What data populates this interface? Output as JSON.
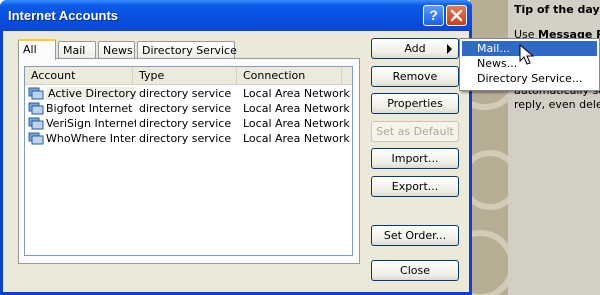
{
  "window": {
    "title": "Internet Accounts",
    "help_label": "?",
    "close_label": "✕"
  },
  "tabs": [
    "All",
    "Mail",
    "News",
    "Directory Service"
  ],
  "list": {
    "columns": [
      "Account",
      "Type",
      "Connection"
    ],
    "rows": [
      {
        "account": "Active Directory",
        "type": "directory service",
        "connection": "Local Area Network"
      },
      {
        "account": "Bigfoot Internet ...",
        "type": "directory service",
        "connection": "Local Area Network"
      },
      {
        "account": "VeriSign Internet ...",
        "type": "directory service",
        "connection": "Local Area Network"
      },
      {
        "account": "WhoWhere Inter...",
        "type": "directory service",
        "connection": "Local Area Network"
      }
    ]
  },
  "buttons": {
    "add": "Add",
    "remove": "Remove",
    "properties": "Properties",
    "set_default": "Set as Default",
    "import": "Import...",
    "export": "Export...",
    "set_order": "Set Order...",
    "close": "Close"
  },
  "add_menu": [
    "Mail...",
    "News...",
    "Directory Service..."
  ],
  "background": {
    "tip_title": "Tip of the day",
    "tip_lines": [
      {
        "pre": "Use ",
        "bold": "Message R"
      },
      {
        "pre": "",
        "bold": ""
      },
      {
        "pre": "",
        "bold": ""
      },
      {
        "pre": "",
        "bold": ""
      },
      {
        "pre": "automatically se",
        "bold": ""
      },
      {
        "pre": "reply, even delet",
        "bold": ""
      }
    ]
  },
  "colors": {
    "titlebar": "#0a4fdf",
    "selection": "#316ac5",
    "dialog_face": "#ece9d8"
  }
}
